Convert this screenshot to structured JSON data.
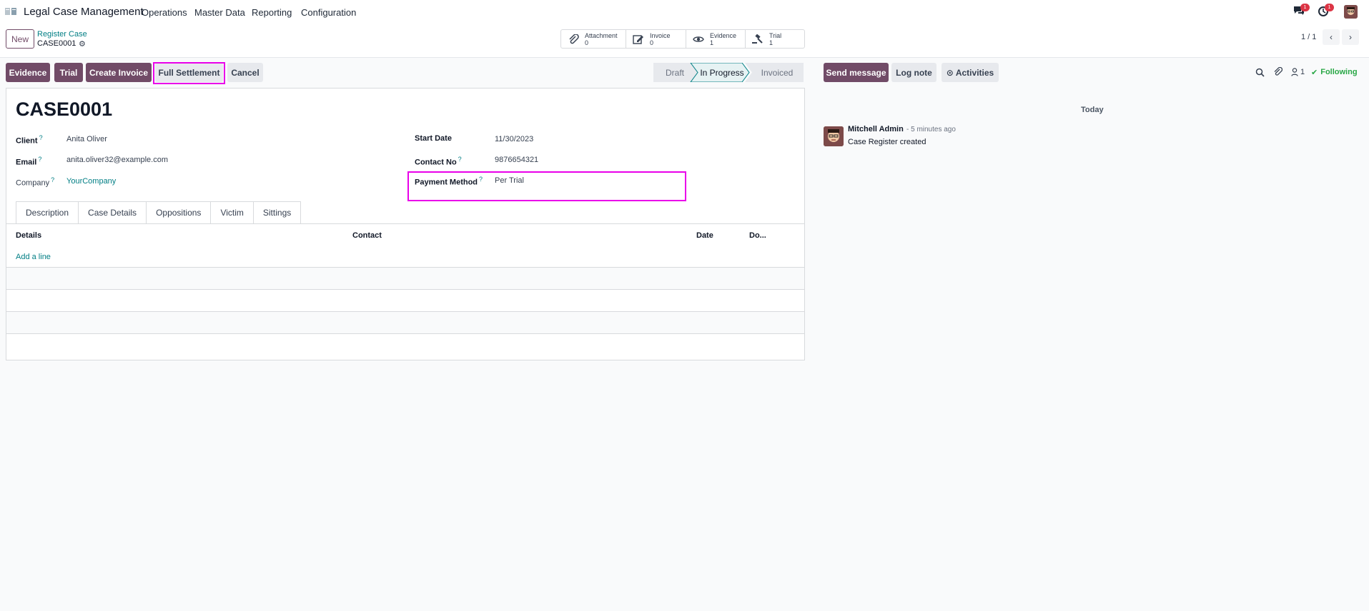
{
  "nav": {
    "app_title": "Legal Case Management",
    "menu": [
      "Operations",
      "Master Data",
      "Reporting",
      "Configuration"
    ],
    "messages_badge": "1",
    "activities_badge": "1"
  },
  "control": {
    "new_label": "New",
    "breadcrumb": "Register Case",
    "record_name": "CASE0001",
    "smart_buttons": [
      {
        "label": "Attachment",
        "count": "0",
        "icon": "paperclip-icon"
      },
      {
        "label": "Invoice",
        "count": "0",
        "icon": "edit-icon"
      },
      {
        "label": "Evidence",
        "count": "1",
        "icon": "eye-icon"
      },
      {
        "label": "Trial",
        "count": "1",
        "icon": "gavel-icon"
      }
    ],
    "pager": "1 / 1"
  },
  "actions": {
    "evidence": "Evidence",
    "trial": "Trial",
    "create_invoice": "Create Invoice",
    "full_settlement": "Full Settlement",
    "cancel": "Cancel"
  },
  "status": {
    "stages": [
      "Draft",
      "In Progress",
      "Invoiced"
    ],
    "current": "In Progress"
  },
  "chatter_actions": {
    "send_message": "Send message",
    "log_note": "Log note",
    "activities": "Activities",
    "followers_count": "1",
    "following": "Following"
  },
  "form": {
    "title": "CASE0001",
    "client_label": "Client",
    "client": "Anita Oliver",
    "email_label": "Email",
    "email": "anita.oliver32@example.com",
    "company_label": "Company",
    "company": "YourCompany",
    "start_date_label": "Start Date",
    "start_date": "11/30/2023",
    "contact_no_label": "Contact No",
    "contact_no": "9876654321",
    "payment_method_label": "Payment Method",
    "payment_method": "Per Trial",
    "help_mark": "?"
  },
  "tabs": [
    "Description",
    "Case Details",
    "Oppositions",
    "Victim",
    "Sittings"
  ],
  "active_tab": "Sittings",
  "table": {
    "headers": [
      "Details",
      "Contact",
      "Date",
      "Do..."
    ],
    "add_line": "Add a line"
  },
  "chatter": {
    "day": "Today",
    "author": "Mitchell Admin",
    "time": "- 5 minutes ago",
    "body": "Case Register created"
  },
  "colors": {
    "primary": "#714b67",
    "link": "#017e84",
    "highlight": "#e900e9",
    "badge": "#dc3545",
    "following": "#28a745"
  }
}
